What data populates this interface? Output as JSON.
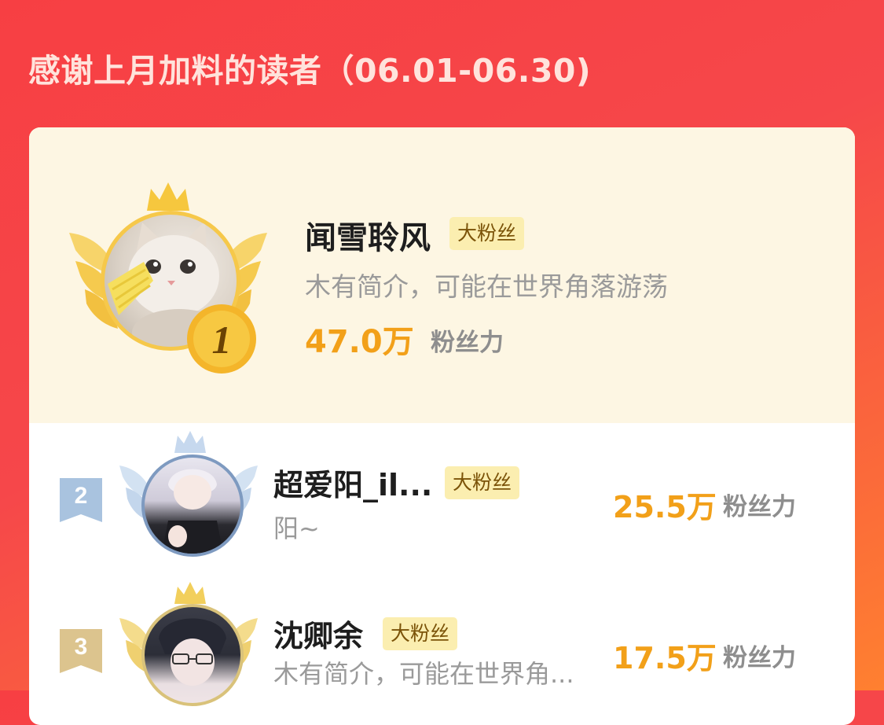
{
  "header": {
    "title": "感谢上月加料的读者（06.01-06.30)"
  },
  "readers": [
    {
      "rank": "1",
      "name": "闻雪聆风",
      "badge": "大粉丝",
      "intro": "木有简介，可能在世界角落游荡",
      "score": "47.0万",
      "score_label": "粉丝力",
      "avatar_icon": "cat-avatar-icon"
    },
    {
      "rank": "2",
      "name": "超爱阳_il...",
      "badge": "大粉丝",
      "intro": "阳~",
      "score": "25.5万",
      "score_label": "粉丝力",
      "avatar_icon": "anime-boy-avatar-icon"
    },
    {
      "rank": "3",
      "name": "沈卿余",
      "badge": "大粉丝",
      "intro": "木有简介，可能在世界角...",
      "score": "17.5万",
      "score_label": "粉丝力",
      "avatar_icon": "anime-boy-glasses-avatar-icon"
    }
  ],
  "colors": {
    "background": "#f6474a",
    "accent_gold": "#f2a019",
    "badge_bg": "#fbeeb0",
    "top_panel": "#fdf6e3",
    "silver": "#a9c3df",
    "bronze": "#dcc48e"
  }
}
